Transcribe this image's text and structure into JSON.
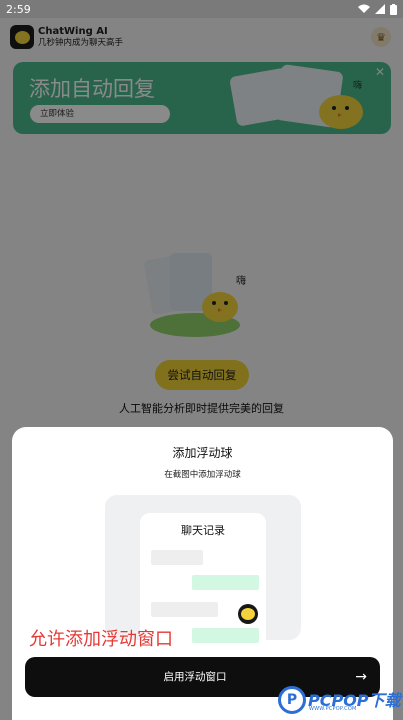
{
  "status_bar": {
    "time": "2:59"
  },
  "header": {
    "title": "ChatWing AI",
    "subtitle": "几秒钟内成为聊天高手"
  },
  "banner": {
    "title": "添加自动回复",
    "button": "立即体验",
    "bubble_text": "嗨"
  },
  "main": {
    "illus_text": "嗨",
    "try_button": "尝试自动回复",
    "description": "人工智能分析即时提供完美的回复"
  },
  "sheet": {
    "title": "添加浮动球",
    "subtitle": "在截图中添加浮动球",
    "phone_title": "聊天记录",
    "annotation": "允许添加浮动窗口",
    "enable_button": "启用浮动窗口",
    "arrow": "→"
  },
  "watermark": {
    "text": "PCPOP下载",
    "small": "WWW.PCPOP.COM"
  },
  "colors": {
    "banner": "#49b98b",
    "accent_yellow": "#efd135",
    "button_dark": "#0e0e0e",
    "annotation_red": "#e53935"
  }
}
